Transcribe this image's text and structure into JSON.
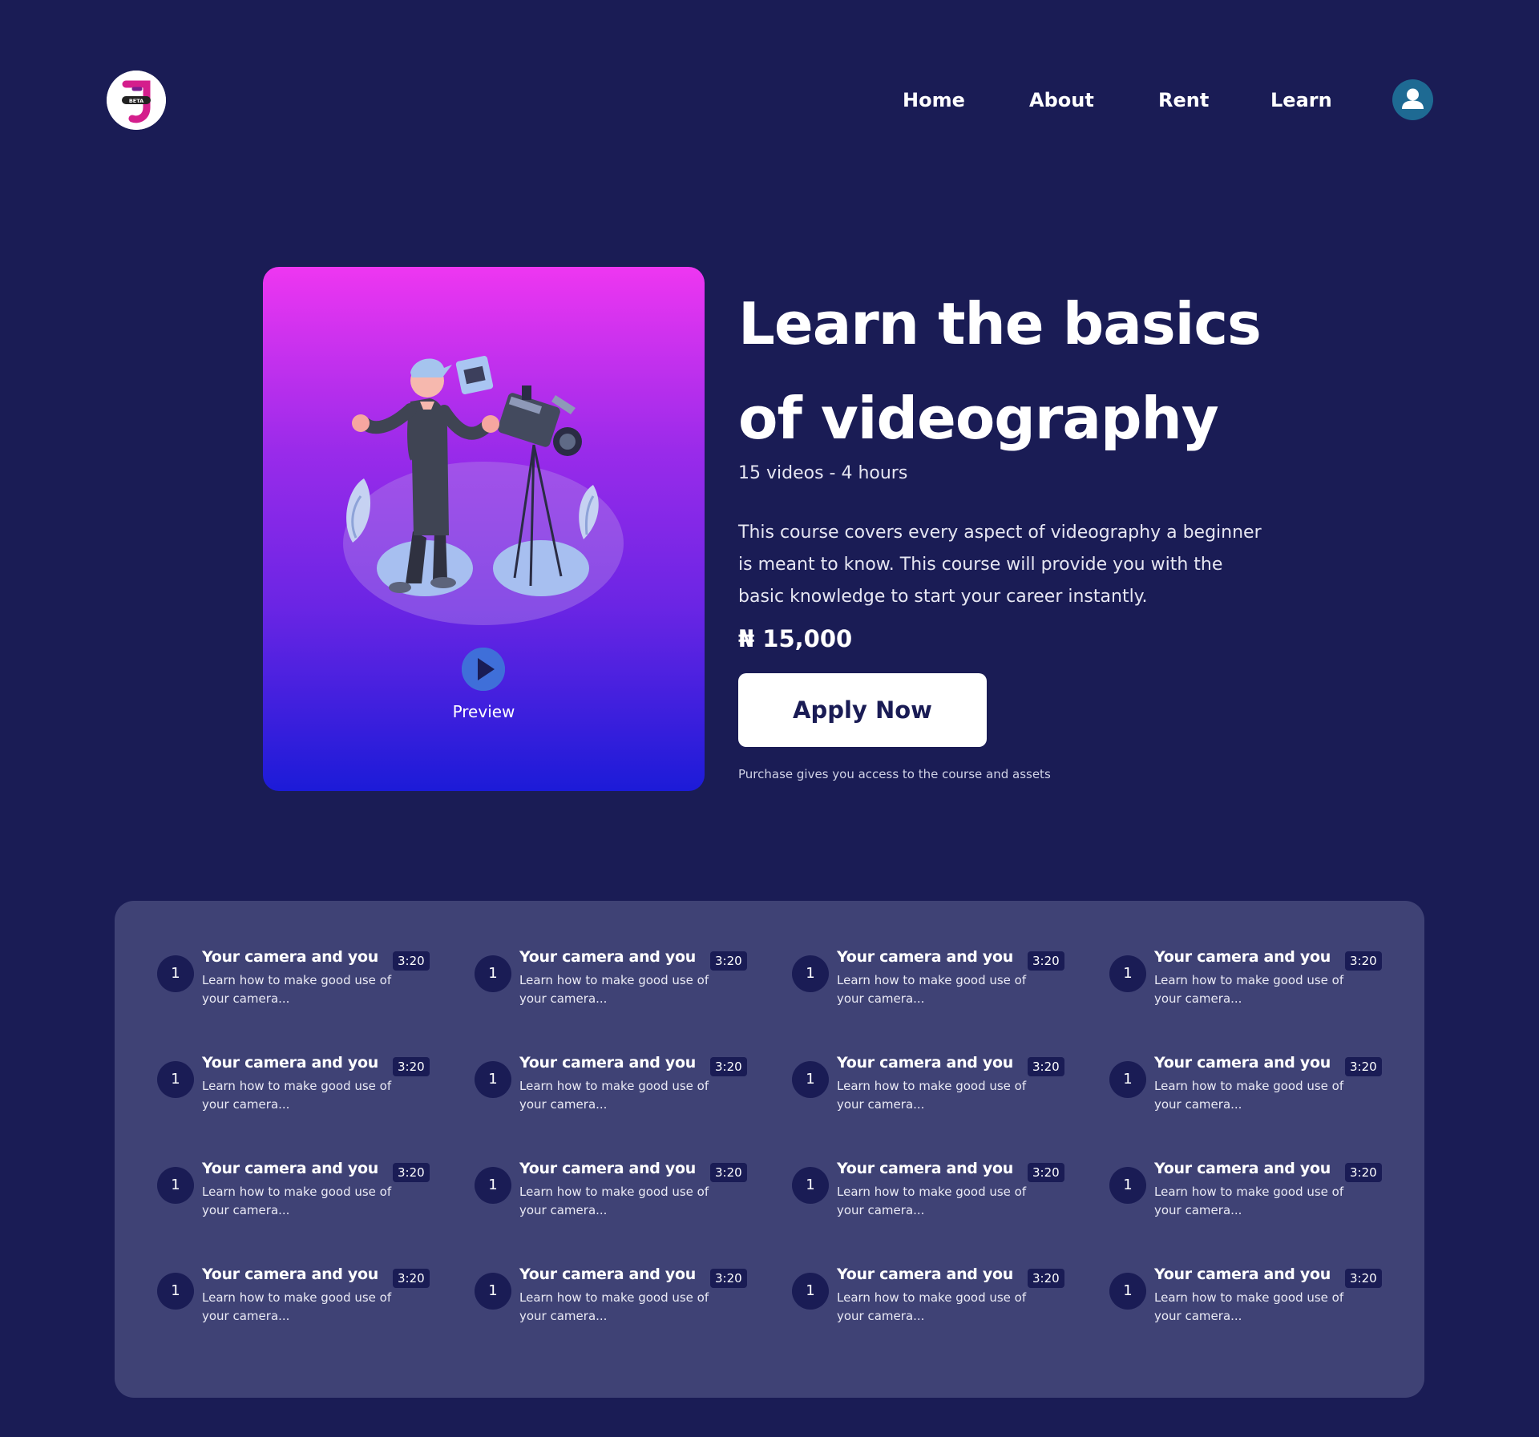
{
  "nav": {
    "logo_badge": "BETA",
    "links": [
      {
        "label": "Home"
      },
      {
        "label": "About"
      },
      {
        "label": "Rent"
      },
      {
        "label": "Learn"
      }
    ],
    "avatar_icon": "user-icon"
  },
  "hero": {
    "preview_label": "Preview",
    "title": "Learn the basics of videography",
    "meta": "15 videos - 4 hours",
    "description": "This course covers every aspect of videography a beginner is meant to know. This course will provide you with the basic knowledge to start your career instantly.",
    "price": "₦ 15,000",
    "apply_label": "Apply Now",
    "purchase_note": "Purchase gives you access to the course and assets"
  },
  "colors": {
    "background": "#1a1c55",
    "panel": "#3f4275",
    "card_gradient_top": "#ee36f1",
    "card_gradient_bottom": "#1c1bd8",
    "accent_play": "#3f6fd9",
    "avatar": "#1e6a93"
  },
  "lessons": [
    {
      "number": "1",
      "title": "Your camera and you",
      "duration": "3:20",
      "description": "Learn how to make good use of your camera..."
    },
    {
      "number": "1",
      "title": "Your camera and you",
      "duration": "3:20",
      "description": "Learn how to make good use of your camera..."
    },
    {
      "number": "1",
      "title": "Your camera and you",
      "duration": "3:20",
      "description": "Learn how to make good use of your camera..."
    },
    {
      "number": "1",
      "title": "Your camera and you",
      "duration": "3:20",
      "description": "Learn how to make good use of your camera..."
    },
    {
      "number": "1",
      "title": "Your camera and you",
      "duration": "3:20",
      "description": "Learn how to make good use of your camera..."
    },
    {
      "number": "1",
      "title": "Your camera and you",
      "duration": "3:20",
      "description": "Learn how to make good use of your camera..."
    },
    {
      "number": "1",
      "title": "Your camera and you",
      "duration": "3:20",
      "description": "Learn how to make good use of your camera..."
    },
    {
      "number": "1",
      "title": "Your camera and you",
      "duration": "3:20",
      "description": "Learn how to make good use of your camera..."
    },
    {
      "number": "1",
      "title": "Your camera and you",
      "duration": "3:20",
      "description": "Learn how to make good use of your camera..."
    },
    {
      "number": "1",
      "title": "Your camera and you",
      "duration": "3:20",
      "description": "Learn how to make good use of your camera..."
    },
    {
      "number": "1",
      "title": "Your camera and you",
      "duration": "3:20",
      "description": "Learn how to make good use of your camera..."
    },
    {
      "number": "1",
      "title": "Your camera and you",
      "duration": "3:20",
      "description": "Learn how to make good use of your camera..."
    },
    {
      "number": "1",
      "title": "Your camera and you",
      "duration": "3:20",
      "description": "Learn how to make good use of your camera..."
    },
    {
      "number": "1",
      "title": "Your camera and you",
      "duration": "3:20",
      "description": "Learn how to make good use of your camera..."
    },
    {
      "number": "1",
      "title": "Your camera and you",
      "duration": "3:20",
      "description": "Learn how to make good use of your camera..."
    },
    {
      "number": "1",
      "title": "Your camera and you",
      "duration": "3:20",
      "description": "Learn how to make good use of your camera..."
    }
  ]
}
